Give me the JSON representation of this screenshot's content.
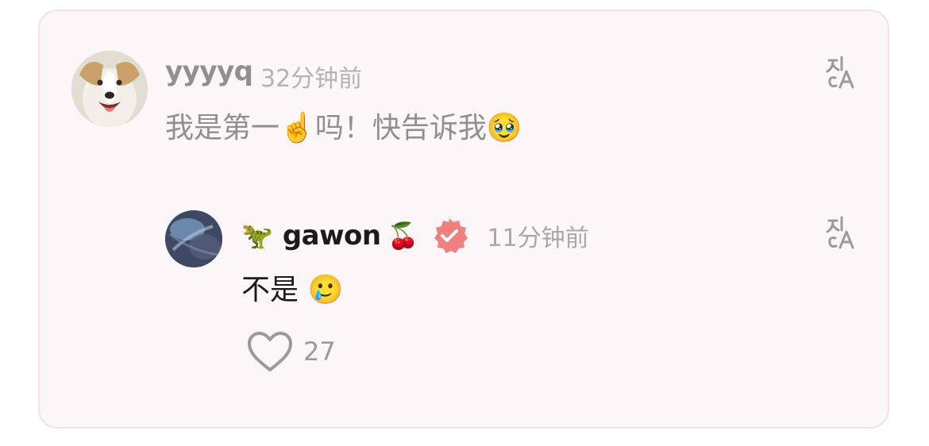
{
  "comment": {
    "username": "yyyyq",
    "timestamp": "32分钟前",
    "text": "我是第一☝️吗！快告诉我🥹",
    "translate_icon": "translate-icon"
  },
  "reply": {
    "prefix_emoji": "🦖",
    "username": "gawon",
    "suffix_emoji": "🍒",
    "verified_icon": "verified-badge-icon",
    "timestamp": "11分钟前",
    "text": "不是 🥲",
    "translate_icon": "translate-icon",
    "like_icon": "heart-icon",
    "like_count": "27"
  },
  "colors": {
    "card_background": "#fdf6f8",
    "card_border": "#f4e1e7",
    "verified_badge": "#f08080",
    "muted_text": "#8f8f8f"
  }
}
